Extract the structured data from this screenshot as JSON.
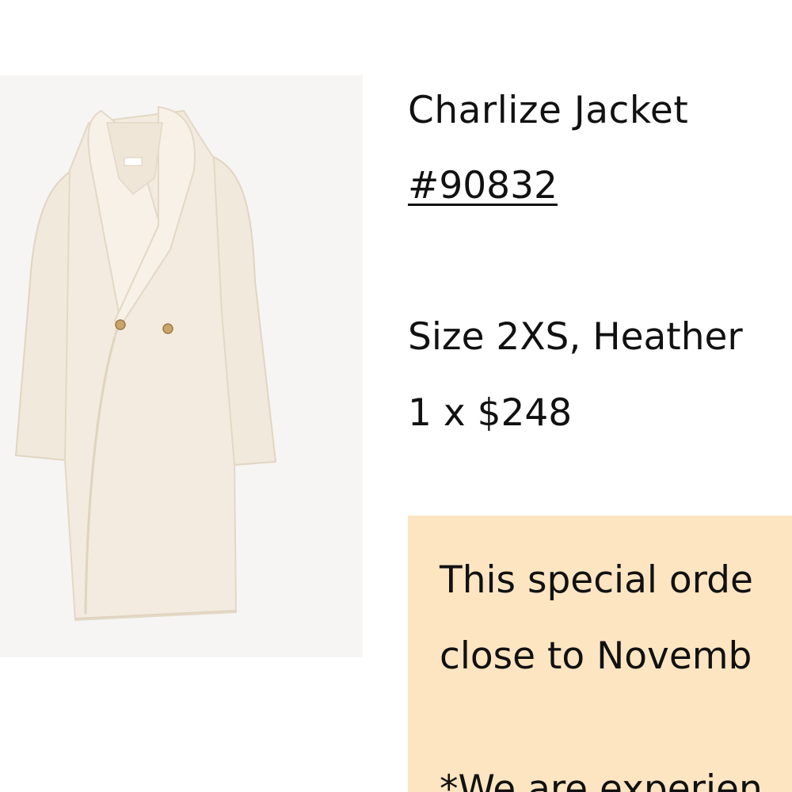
{
  "product": {
    "name": "Charlize Jacket",
    "sku": "#90832",
    "variant": "Size 2XS, Heather",
    "price_line": "1 x $248",
    "image_icon": "coat-image"
  },
  "notice": {
    "line1": "This special orde",
    "line2": "close to Novemb",
    "line3": "*We are experien",
    "background_color": "#fde5c2"
  }
}
